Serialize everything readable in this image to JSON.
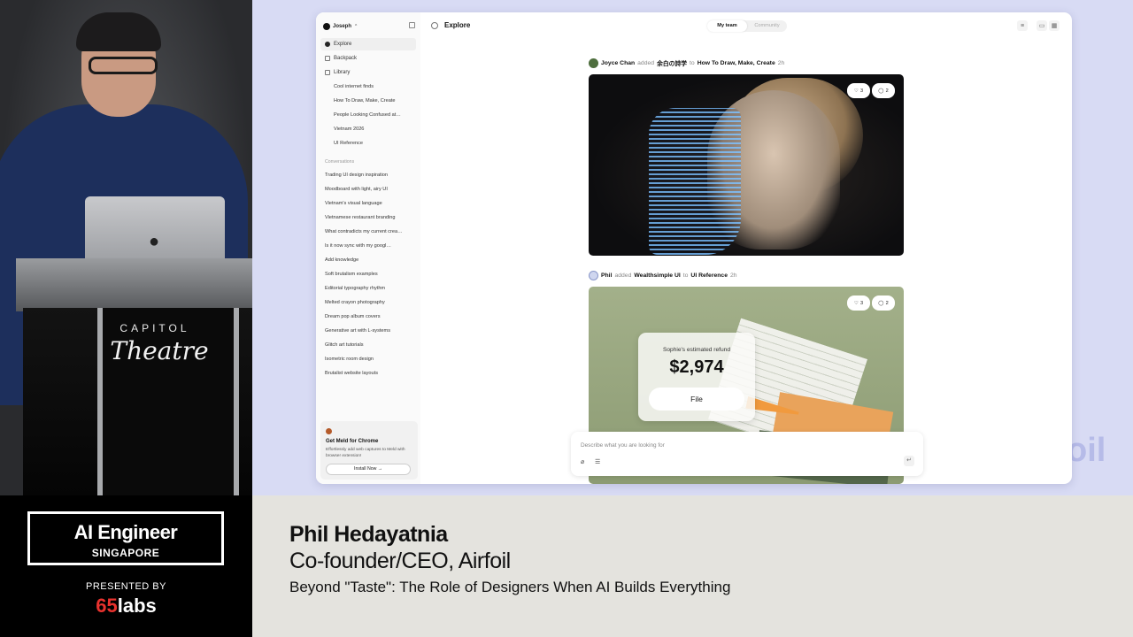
{
  "camera": {
    "podium_line1": "CAPITOL",
    "podium_line2": "Theatre"
  },
  "slide": {
    "bg_word": "oil",
    "app": {
      "account": {
        "name": "Joseph",
        "caret": "⌃"
      },
      "sidebar": {
        "nav": [
          {
            "label": "Explore",
            "active": true
          },
          {
            "label": "Backpack",
            "active": false
          },
          {
            "label": "Library",
            "active": false
          }
        ],
        "library_items": [
          "Cool internet finds",
          "How To Draw, Make, Create",
          "People Looking Confused at…",
          "Vietnam 2026",
          "UI Reference"
        ],
        "conversations_heading": "Conversations",
        "conversations": [
          "Trading UI design inspiration",
          "Moodboard with light, airy UI",
          "Vietnam's visual language",
          "Vietnamese restaurant branding",
          "What contradicts my current crea…",
          "Is it now sync with my googl…",
          "Add knowledge",
          "Soft brutalism examples",
          "Editorial typography rhythm",
          "Melted crayon photography",
          "Dream pop album covers",
          "Generative art with L-systems",
          "Glitch art tutorials",
          "Isometric room design",
          "Brutalist website layouts"
        ],
        "promo": {
          "title": "Get Meld for Chrome",
          "desc": "Effortlessly add web captures to Meld with browser extension!",
          "button": "Install Now →"
        }
      },
      "main": {
        "title": "Explore",
        "tabs": [
          {
            "label": "My team",
            "active": true
          },
          {
            "label": "Community",
            "active": false
          }
        ],
        "feed": [
          {
            "user": "Joyce Chan",
            "verb": "added",
            "item": "余白の詩学",
            "prep": "to",
            "collection": "How To Draw, Make, Create",
            "time": "2h",
            "likes": "3",
            "comments": "2"
          },
          {
            "user": "Phil",
            "verb": "added",
            "item": "Wealthsimple UI",
            "prep": "to",
            "collection": "UI Reference",
            "time": "2h",
            "likes": "3",
            "comments": "2",
            "refund_label": "Sophie's estimated refund",
            "refund_amount": "$2,974",
            "refund_button": "File"
          }
        ],
        "prompt": {
          "placeholder": "Describe what you are looking for",
          "send": "↵"
        }
      }
    }
  },
  "brand": {
    "event_title": "AI Engineer",
    "event_sub": "SINGAPORE",
    "presented_by": "PRESENTED BY",
    "sponsor_num": "65",
    "sponsor_word": "labs"
  },
  "speaker": {
    "name": "Phil Hedayatnia",
    "role": "Co-founder/CEO, Airfoil",
    "talk": "Beyond \"Taste\": The Role of Designers When AI Builds Everything"
  },
  "colors": {
    "slide_bg": "#d8dbf4",
    "lower_third_bg": "#e4e3de",
    "sponsor_accent": "#e8322e"
  }
}
